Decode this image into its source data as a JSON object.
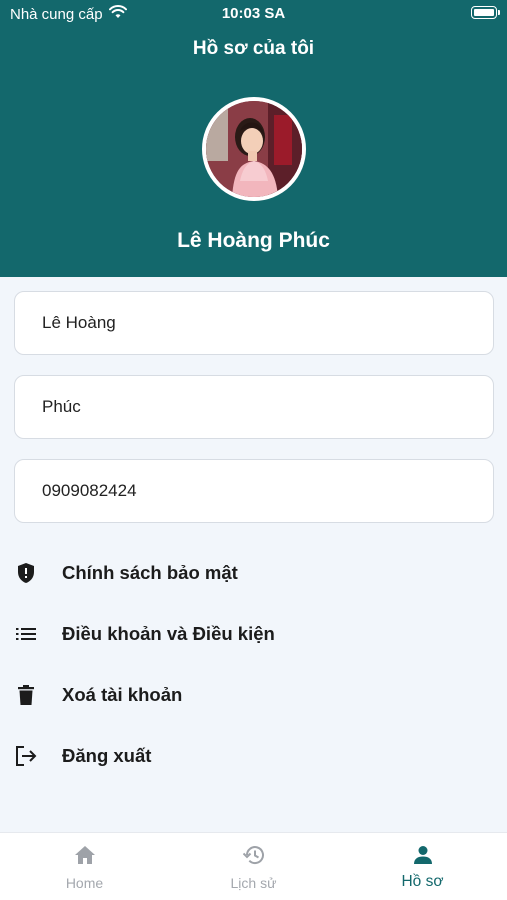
{
  "status_bar": {
    "carrier": "Nhà cung cấp",
    "time": "10:03 SA"
  },
  "header": {
    "title": "Hồ sơ của tôi",
    "user_name": "Lê Hoàng Phúc"
  },
  "form": {
    "last_name": "Lê Hoàng",
    "first_name": "Phúc",
    "phone": "0909082424"
  },
  "menu": {
    "items": [
      {
        "label": "Chính sách bảo mật",
        "icon": "shield-icon"
      },
      {
        "label": "Điều khoản và Điều kiện",
        "icon": "list-icon"
      },
      {
        "label": "Xoá tài khoản",
        "icon": "trash-icon"
      },
      {
        "label": "Đăng xuất",
        "icon": "logout-icon"
      }
    ]
  },
  "tabbar": {
    "tabs": [
      {
        "label": "Home",
        "icon": "home-icon",
        "active": false
      },
      {
        "label": "Lịch sử",
        "icon": "history-icon",
        "active": false
      },
      {
        "label": "Hồ sơ",
        "icon": "person-icon",
        "active": true
      }
    ]
  },
  "colors": {
    "header_bg": "#13686c",
    "page_bg": "#f2f6fb",
    "active_tab": "#13686c",
    "inactive_tab": "#a4a8ae"
  }
}
